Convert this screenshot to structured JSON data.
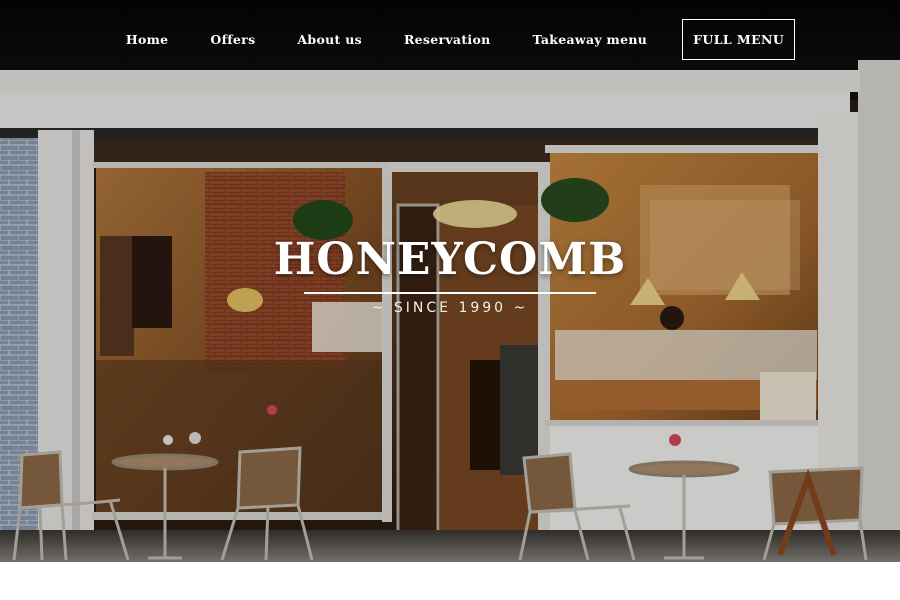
{
  "nav": {
    "items": [
      {
        "label": "Home"
      },
      {
        "label": "Offers"
      },
      {
        "label": "About us"
      },
      {
        "label": "Reservation"
      },
      {
        "label": "Takeaway menu"
      }
    ],
    "cta_label": "FULL MENU"
  },
  "hero": {
    "title": "HONEYCOMB",
    "subtitle": "~ SINCE 1990 ~",
    "image": "cafe-storefront-photo"
  },
  "colors": {
    "nav_text": "#ffffff",
    "hero_text": "#ffffff",
    "interior_warm": "#c98a43",
    "frame": "#e6e6e2"
  }
}
